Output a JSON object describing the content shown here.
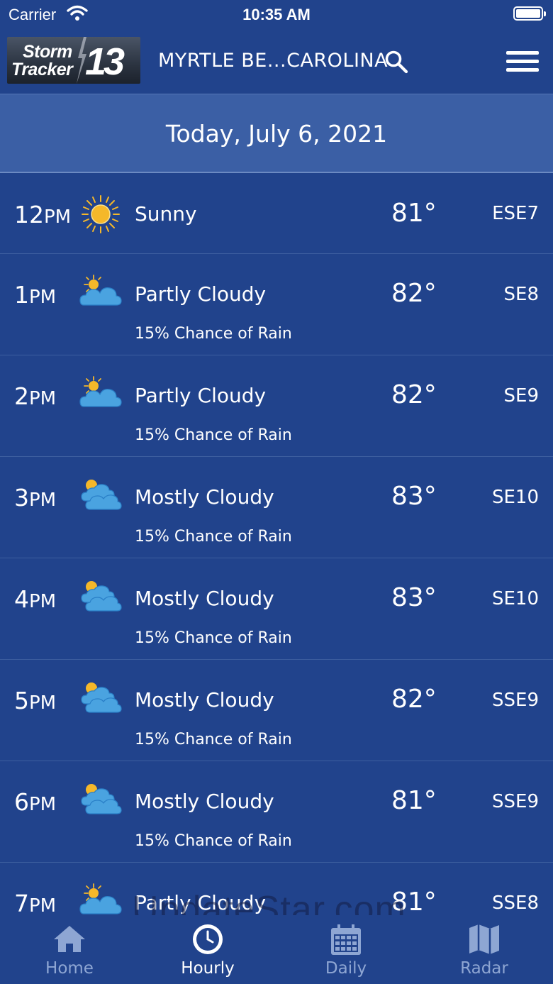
{
  "status_bar": {
    "carrier": "Carrier",
    "time": "10:35 AM"
  },
  "header": {
    "logo_line1": "Storm",
    "logo_line2": "Tracker",
    "logo_number": "13",
    "location": "MYRTLE BE...CAROLINA",
    "icons": [
      "search-icon",
      "menu-icon"
    ]
  },
  "date_banner": "Today, July 6, 2021",
  "hourly": [
    {
      "hour": "12",
      "ampm": "PM",
      "icon": "sunny",
      "condition": "Sunny",
      "rain": "",
      "temp": "81°",
      "wind": "ESE7"
    },
    {
      "hour": "1",
      "ampm": "PM",
      "icon": "partly-cloudy",
      "condition": "Partly Cloudy",
      "rain": "15% Chance of Rain",
      "temp": "82°",
      "wind": "SE8"
    },
    {
      "hour": "2",
      "ampm": "PM",
      "icon": "partly-cloudy",
      "condition": "Partly Cloudy",
      "rain": "15% Chance of Rain",
      "temp": "82°",
      "wind": "SE9"
    },
    {
      "hour": "3",
      "ampm": "PM",
      "icon": "mostly-cloudy",
      "condition": "Mostly Cloudy",
      "rain": "15% Chance of Rain",
      "temp": "83°",
      "wind": "SE10"
    },
    {
      "hour": "4",
      "ampm": "PM",
      "icon": "mostly-cloudy",
      "condition": "Mostly Cloudy",
      "rain": "15% Chance of Rain",
      "temp": "83°",
      "wind": "SE10"
    },
    {
      "hour": "5",
      "ampm": "PM",
      "icon": "mostly-cloudy",
      "condition": "Mostly Cloudy",
      "rain": "15% Chance of Rain",
      "temp": "82°",
      "wind": "SSE9"
    },
    {
      "hour": "6",
      "ampm": "PM",
      "icon": "mostly-cloudy",
      "condition": "Mostly Cloudy",
      "rain": "15% Chance of Rain",
      "temp": "81°",
      "wind": "SSE9"
    },
    {
      "hour": "7",
      "ampm": "PM",
      "icon": "partly-cloudy",
      "condition": "Partly Cloudy",
      "rain": "",
      "temp": "81°",
      "wind": "SSE8"
    }
  ],
  "nav": {
    "home": "Home",
    "hourly": "Hourly",
    "daily": "Daily",
    "radar": "Radar",
    "active": "hourly"
  },
  "watermark": "UpdateStar.com",
  "colors": {
    "background": "#21438c",
    "banner": "#3b5fa5",
    "nav_inactive": "#8ea6d3",
    "sun": "#f5b82a",
    "cloud": "#4aa3e0"
  }
}
